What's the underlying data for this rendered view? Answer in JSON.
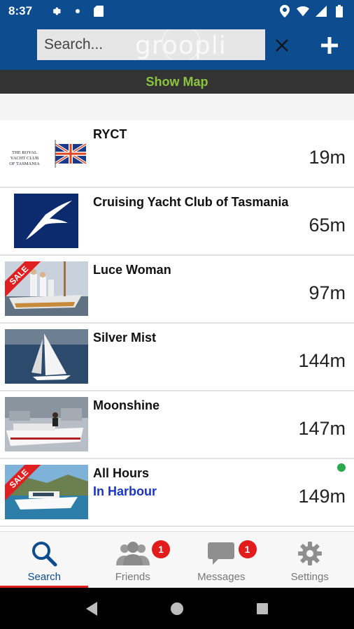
{
  "status_bar": {
    "time": "8:37",
    "left_icons": [
      "gear-icon",
      "dot-icon",
      "sd-card-icon"
    ],
    "right_icons": [
      "location-icon",
      "wifi-icon",
      "cell-signal-icon",
      "battery-icon"
    ]
  },
  "app_bar": {
    "search_placeholder": "Search...",
    "brand_watermark": "groopli",
    "clear_icon": "close-icon",
    "add_icon": "plus-icon"
  },
  "show_map_label": "Show Map",
  "results": [
    {
      "name": "RYCT",
      "subtitle": "",
      "distance": "19m",
      "sale": false,
      "online": false,
      "thumb": "ryct-logo",
      "logo_text": "THE ROYAL YACHT CLUB OF TASMANIA"
    },
    {
      "name": "Cruising Yacht Club of Tasmania",
      "subtitle": "",
      "distance": "65m",
      "sale": false,
      "online": false,
      "thumb": "albatross-logo"
    },
    {
      "name": "Luce Woman",
      "subtitle": "",
      "distance": "97m",
      "sale": true,
      "sale_label": "SALE",
      "online": false,
      "thumb": "sailboat-crew-photo"
    },
    {
      "name": "Silver Mist",
      "subtitle": "",
      "distance": "144m",
      "sale": false,
      "online": false,
      "thumb": "sailboat-photo"
    },
    {
      "name": "Moonshine",
      "subtitle": "",
      "distance": "147m",
      "sale": false,
      "online": false,
      "thumb": "motorboat-photo"
    },
    {
      "name": "All Hours",
      "subtitle": "In Harbour",
      "distance": "149m",
      "sale": true,
      "sale_label": "SALE",
      "online": true,
      "thumb": "cruiser-photo"
    }
  ],
  "bottom_nav": {
    "tabs": [
      {
        "label": "Search",
        "icon": "search-icon",
        "active": true,
        "badge": ""
      },
      {
        "label": "Friends",
        "icon": "friends-icon",
        "active": false,
        "badge": "1"
      },
      {
        "label": "Messages",
        "icon": "chat-icon",
        "active": false,
        "badge": "1"
      },
      {
        "label": "Settings",
        "icon": "gear-icon",
        "active": false,
        "badge": ""
      }
    ]
  },
  "colors": {
    "brand_blue": "#0d4c8f",
    "show_map_green": "#8bc53f",
    "badge_red": "#e21b1b",
    "status_blue": "#1a35c6",
    "online_green": "#2aa84a"
  }
}
